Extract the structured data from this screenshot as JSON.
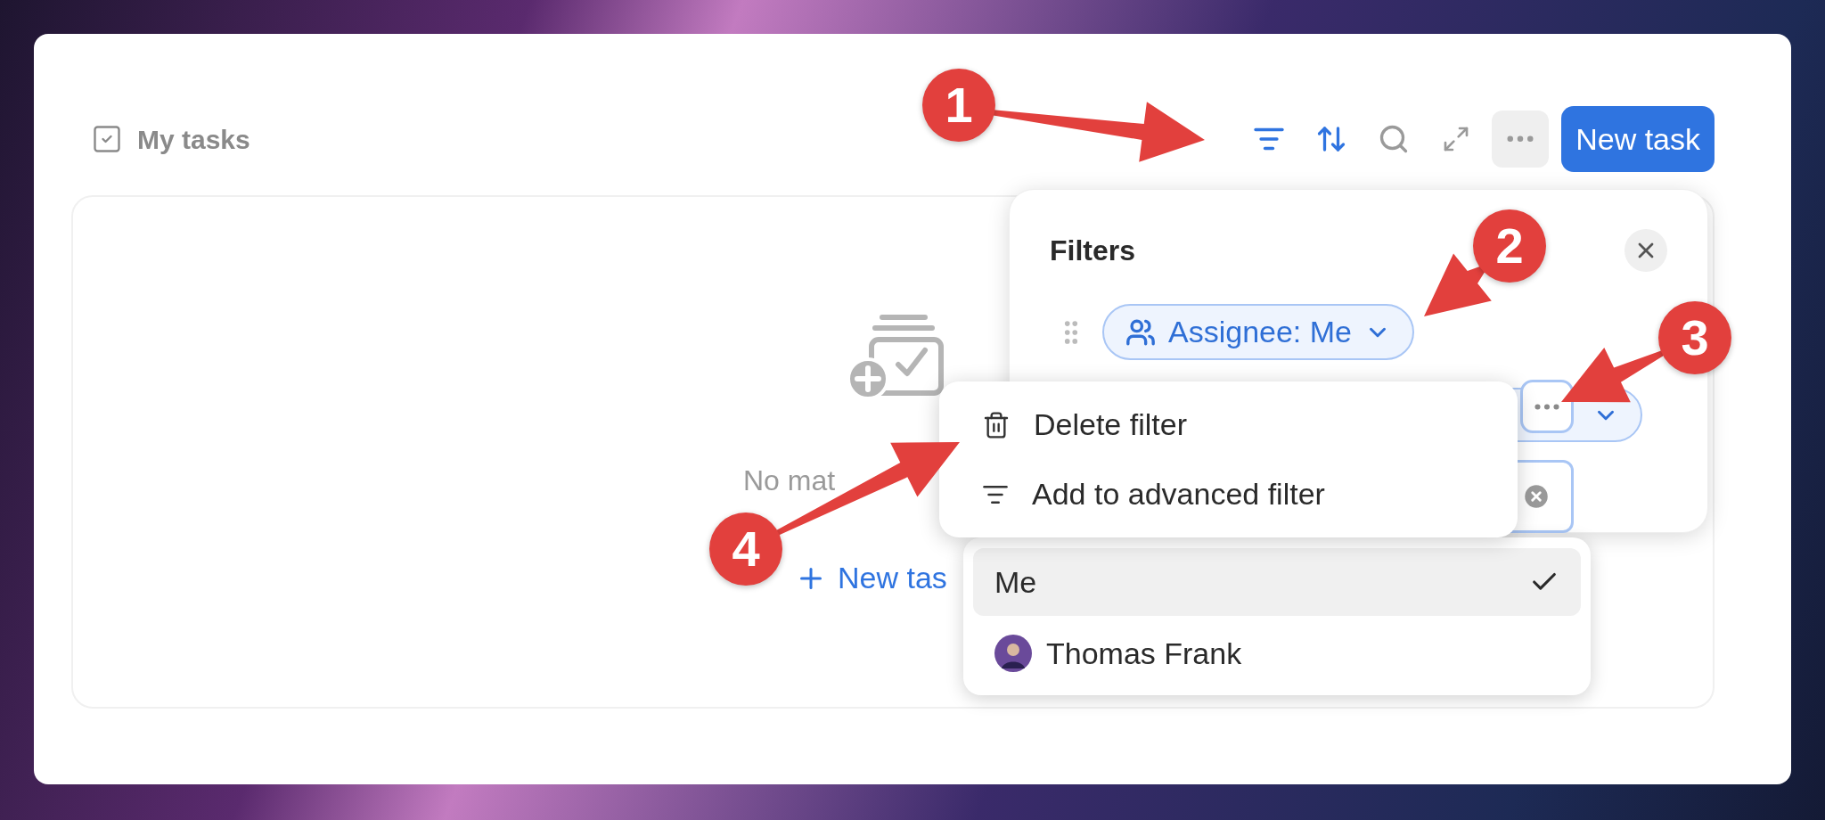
{
  "header": {
    "title": "My tasks"
  },
  "toolbar": [
    {
      "kind": "filter",
      "active": true
    },
    {
      "kind": "sort",
      "active": true
    },
    {
      "kind": "search",
      "active": false
    },
    {
      "kind": "expand",
      "active": false
    },
    {
      "kind": "more",
      "active": false
    }
  ],
  "new_task_button": "New task",
  "empty_state": {
    "message": "No mat",
    "new_task_link": "New tas"
  },
  "filters_panel": {
    "title": "Filters",
    "filters": [
      {
        "label": "Assignee: Me"
      }
    ]
  },
  "context_menu": {
    "items": [
      {
        "kind": "delete",
        "label": "Delete filter"
      },
      {
        "kind": "advanced",
        "label": "Add to advanced filter"
      }
    ]
  },
  "options": [
    {
      "kind": "self",
      "label": "Me",
      "selected": true
    },
    {
      "kind": "person",
      "label": "Thomas Frank",
      "selected": false
    }
  ],
  "annotations": [
    {
      "label": "1"
    },
    {
      "label": "2"
    },
    {
      "label": "3"
    },
    {
      "label": "4"
    }
  ]
}
